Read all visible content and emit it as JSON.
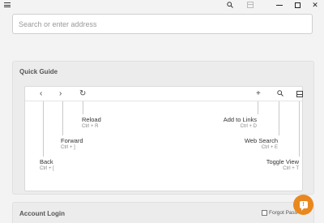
{
  "window": {
    "menu_icon": "hamburger-icon",
    "search_icon": "search-icon",
    "view_icon": "toggle-view-icon",
    "minimize_icon": "minimize-icon",
    "maximize_icon": "maximize-icon",
    "close_icon": "close-icon",
    "close_glyph": "✕"
  },
  "address": {
    "placeholder": "Search or enter address"
  },
  "quick_guide": {
    "title": "Quick Guide",
    "toolbar": {
      "back_glyph": "‹",
      "forward_glyph": "›",
      "reload_glyph": "↻",
      "add_glyph": "+",
      "search_glyph": "⌕"
    },
    "items": [
      {
        "name": "Reload",
        "key": "Ctrl + R"
      },
      {
        "name": "Forward",
        "key": "Ctrl + ]"
      },
      {
        "name": "Back",
        "key": "Ctrl + ["
      },
      {
        "name": "Add to Links",
        "key": "Ctrl + D"
      },
      {
        "name": "Web Search",
        "key": "Ctrl + E"
      },
      {
        "name": "Toggle View",
        "key": "Ctrl + T"
      }
    ]
  },
  "account": {
    "title": "Account Login",
    "forgot_label": "Forgot Pass"
  },
  "fab": {
    "glyph": "!",
    "color": "#e8881f"
  },
  "colors": {
    "accent": "#e8881f"
  }
}
